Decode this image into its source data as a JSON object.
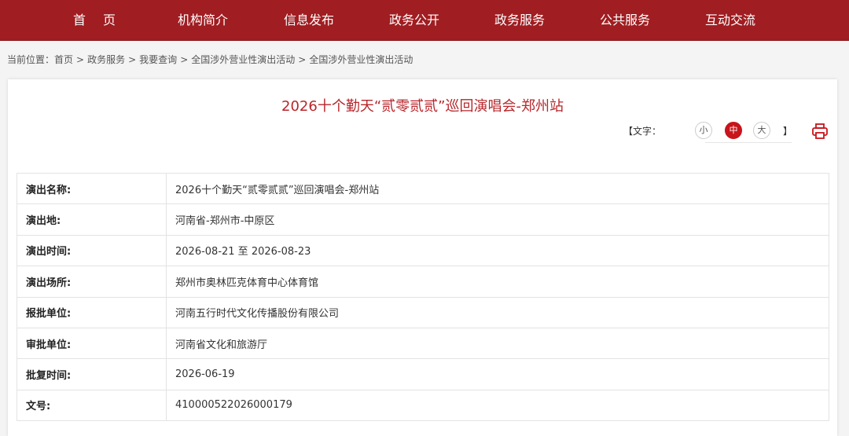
{
  "nav": {
    "items": [
      "首页",
      "机构简介",
      "信息发布",
      "政务公开",
      "政务服务",
      "公共服务",
      "互动交流"
    ]
  },
  "breadcrumb": {
    "prefix": "当前位置：",
    "items": [
      "首页",
      "政务服务",
      "我要查询",
      "全国涉外营业性演出活动",
      "全国涉外营业性演出活动"
    ],
    "separator": ">"
  },
  "article": {
    "title": "2026十个勤天“贰零贰贰”巡回演唱会-郑州站"
  },
  "fontsize": {
    "label": "【文字：",
    "small": "小",
    "medium": "中",
    "large": "大",
    "close": "】",
    "active": "medium"
  },
  "print": {
    "icon": "printer-icon"
  },
  "details": [
    {
      "label": "演出名称:",
      "value": "2026十个勤天“贰零贰贰”巡回演唱会-郑州站"
    },
    {
      "label": "演出地:",
      "value": "河南省-郑州市-中原区"
    },
    {
      "label": "演出时间:",
      "value": "2026-08-21 至 2026-08-23"
    },
    {
      "label": "演出场所:",
      "value": "郑州市奥林匹克体育中心体育馆"
    },
    {
      "label": "报批单位:",
      "value": "河南五行时代文化传播股份有限公司"
    },
    {
      "label": "审批单位:",
      "value": "河南省文化和旅游厅"
    },
    {
      "label": "批复时间:",
      "value": "2026-06-19"
    },
    {
      "label": "文号:",
      "value": "410000522026000179"
    }
  ],
  "colors": {
    "nav_bg": "#a01d21",
    "title": "#b8262b",
    "accent": "#c8141b"
  }
}
